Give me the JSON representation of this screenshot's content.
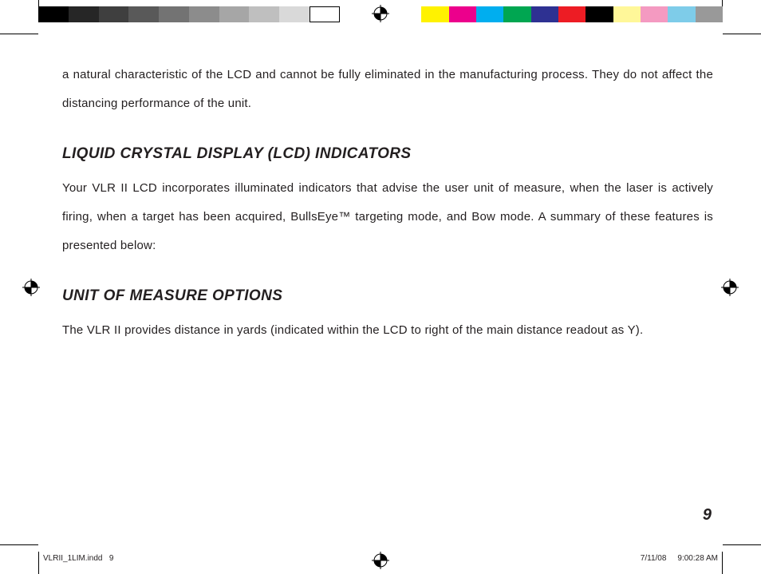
{
  "colorbar_left": [
    "#000000",
    "#262626",
    "#3f3f3f",
    "#595959",
    "#737373",
    "#8c8c8c",
    "#a6a6a6",
    "#bfbfbf",
    "#d9d9d9",
    "#ffffff"
  ],
  "colorbar_right": [
    "#fff200",
    "#ec008c",
    "#00aeef",
    "#00a651",
    "#2e3192",
    "#ed1c24",
    "#000000",
    "#fff799",
    "#f49ac1",
    "#7ecce9",
    "#999999"
  ],
  "intro_continuation": "a natural characteristic of the LCD and cannot be fully eliminated in the manufacturing process. They do not affect the distancing performance of the unit.",
  "section1": {
    "heading": "LIQUID CRYSTAL DISPLAY (LCD) INDICATORS",
    "body": "Your VLR II LCD incorporates illuminated indicators that advise the user unit of measure, when the laser is actively firing, when a target has been acquired, BullsEye™ targeting mode, and Bow mode. A summary of these features is presented below:"
  },
  "section2": {
    "heading": "UNIT OF MEASURE OPTIONS",
    "body": "The VLR II provides distance in yards (indicated within the LCD to right of the main distance readout as Y)."
  },
  "page_number": "9",
  "footer": {
    "file": "VLRII_1LIM.indd",
    "page": "9",
    "date": "7/11/08",
    "time": "9:00:28 AM"
  }
}
